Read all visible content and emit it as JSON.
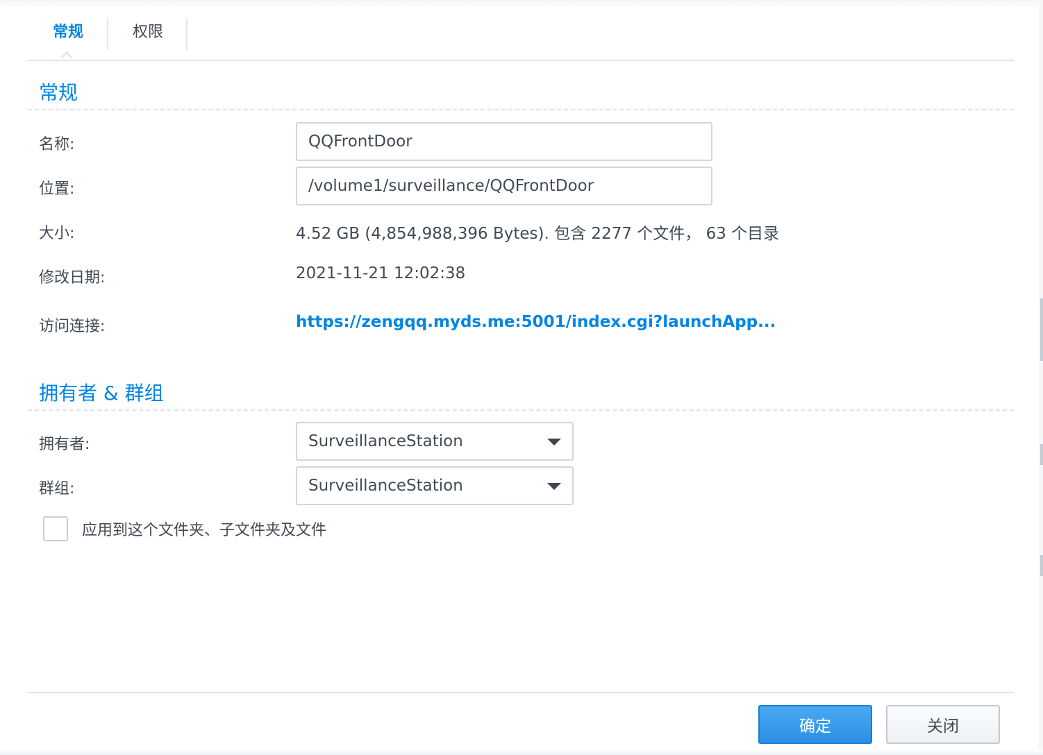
{
  "tabs": {
    "general": "常规",
    "permission": "权限"
  },
  "general_section": {
    "title": "常规",
    "name_label": "名称:",
    "name_value": "QQFrontDoor",
    "location_label": "位置:",
    "location_value": "/volume1/surveillance/QQFrontDoor",
    "size_label": "大小:",
    "size_value": "4.52 GB (4,854,988,396 Bytes). 包含 2277 个文件， 63 个目录",
    "modified_label": "修改日期:",
    "modified_value": "2021-11-21 12:02:38",
    "link_label": "访问连接:",
    "link_value": "https://zengqq.myds.me:5001/index.cgi?launchApp..."
  },
  "owner_section": {
    "title": "拥有者 & 群组",
    "owner_label": "拥有者:",
    "owner_value": "SurveillanceStation",
    "group_label": "群组:",
    "group_value": "SurveillanceStation",
    "apply_label": "应用到这个文件夹、子文件夹及文件",
    "apply_checked": false
  },
  "footer": {
    "ok_label": "确定",
    "close_label": "关闭"
  },
  "colors": {
    "accent": "#0086e5",
    "primary_button": "#2b8fe4",
    "text": "#414b55"
  },
  "icons": {
    "dropdown": "chevron-down-icon",
    "tab_indicator": "caret-up-icon"
  }
}
